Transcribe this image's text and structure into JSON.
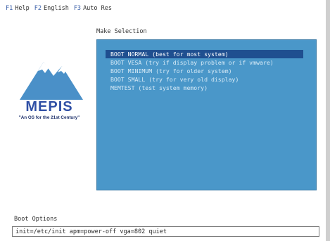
{
  "top_bar": {
    "items": [
      {
        "key": "F1",
        "label": "Help"
      },
      {
        "key": "F2",
        "label": "English"
      },
      {
        "key": "F3",
        "label": "Auto Res"
      }
    ]
  },
  "logo": {
    "name": "MEPIS",
    "tagline": "\"An OS for the 21st Century\""
  },
  "menu": {
    "heading": "Make Selection",
    "items": [
      {
        "label": "BOOT NORMAL (best for most system)",
        "selected": true
      },
      {
        "label": "BOOT VESA (try if display problem or if vmware)",
        "selected": false
      },
      {
        "label": "BOOT MINIMUM (try for older system)",
        "selected": false
      },
      {
        "label": "BOOT SMALL (try for very old display)",
        "selected": false
      },
      {
        "label": "MEMTEST (test system memory)",
        "selected": false
      }
    ]
  },
  "boot_options": {
    "label": "Boot Options",
    "value": "init=/etc/init apm=power-off vga=802 quiet"
  },
  "colors": {
    "panel": "#4a97c9",
    "selection": "#1f4f90",
    "fkey": "#3a5fa8",
    "logo_blue": "#2f4fa5",
    "mountain": "#4a90c8"
  }
}
